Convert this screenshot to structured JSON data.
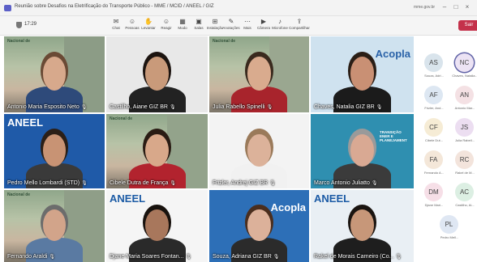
{
  "window": {
    "title": "Reunião sobre Desafios na Eletrificação do Transporte Público - MME / MCID / ANEEL / GIZ",
    "domain": "mme.gov.br"
  },
  "toolbar": {
    "timer": "17:29",
    "buttons": [
      {
        "label": "Chat",
        "icon": "chat-icon",
        "glyph": "✉"
      },
      {
        "label": "Pessoas",
        "icon": "people-icon",
        "glyph": "☺"
      },
      {
        "label": "Levantar",
        "icon": "raise-hand-icon",
        "glyph": "✋"
      },
      {
        "label": "Reagir",
        "icon": "react-icon",
        "glyph": "☺"
      },
      {
        "label": "Modo",
        "icon": "view-icon",
        "glyph": "▦"
      },
      {
        "label": "Salas",
        "icon": "rooms-icon",
        "glyph": "▣"
      },
      {
        "label": "Instalação",
        "icon": "apps-icon",
        "glyph": "⊞"
      },
      {
        "label": "Anotações",
        "icon": "notes-icon",
        "glyph": "✎"
      },
      {
        "label": "Mais",
        "icon": "more-icon",
        "glyph": "⋯"
      },
      {
        "label": "Câmera",
        "icon": "camera-icon",
        "glyph": "▶"
      },
      {
        "label": "Microfone",
        "icon": "microphone-icon",
        "glyph": "♪"
      },
      {
        "label": "Compartilhar",
        "icon": "share-icon",
        "glyph": "⇪"
      }
    ],
    "leave_label": "Sair"
  },
  "tiles": [
    {
      "name": "Antonio Maria Esposito Neto",
      "label_top": "Nacional de"
    },
    {
      "name": "Castilho, Aiane GIZ BR",
      "label_top": ""
    },
    {
      "name": "Julia Rabello Spinelli",
      "label_top": "Nacional de"
    },
    {
      "name": "Chaves, Natalia GIZ BR",
      "label_top": "Acopla"
    },
    {
      "name": "Pedro Mello Lombardi (STD)",
      "label_top": "ANEEL"
    },
    {
      "name": "Cibele Dutra de França",
      "label_top": "Nacional de"
    },
    {
      "name": "Frizler, Andrej GIZ BR",
      "label_top": ""
    },
    {
      "name": "Marco Antonio Juliatto",
      "label_top": "TRANSIÇÃO ENER E PLANEJAMENT"
    },
    {
      "name": "Fernando Araldi",
      "label_top": "Nacional de"
    },
    {
      "name": "Djane Maria Soares Fontan...",
      "label_top": "ANEEL"
    },
    {
      "name": "Souza, Adriana GIZ BR",
      "label_top": "Acopla"
    },
    {
      "name": "Rakel de Morais Carneiro (Co...",
      "label_top": "ANEEL"
    }
  ],
  "roster": [
    {
      "initials": "AS",
      "name": "Souza, Adri...",
      "color": "#d9e4ec"
    },
    {
      "initials": "NC",
      "name": "Chaves, Natalia...",
      "color": "#ece3f4"
    },
    {
      "initials": "AF",
      "name": "Frizler, And...",
      "color": "#dde7f2"
    },
    {
      "initials": "AN",
      "name": "Antonio Mar...",
      "color": "#f4e1e4"
    },
    {
      "initials": "CF",
      "name": "Cibele Dut...",
      "color": "#f6ecd5"
    },
    {
      "initials": "JS",
      "name": "Julia Rabell...",
      "color": "#ecdef1"
    },
    {
      "initials": "FA",
      "name": "Fernando A...",
      "color": "#f4e7d9"
    },
    {
      "initials": "RC",
      "name": "Rakel de M...",
      "color": "#f3e4dc"
    },
    {
      "initials": "DM",
      "name": "Djane Mari...",
      "color": "#f6dfe7"
    },
    {
      "initials": "AC",
      "name": "Castilho, Ai...",
      "color": "#dcefe3"
    },
    {
      "initials": "PL",
      "name": "Pedro Mell...",
      "color": "#dfe7f3"
    }
  ]
}
